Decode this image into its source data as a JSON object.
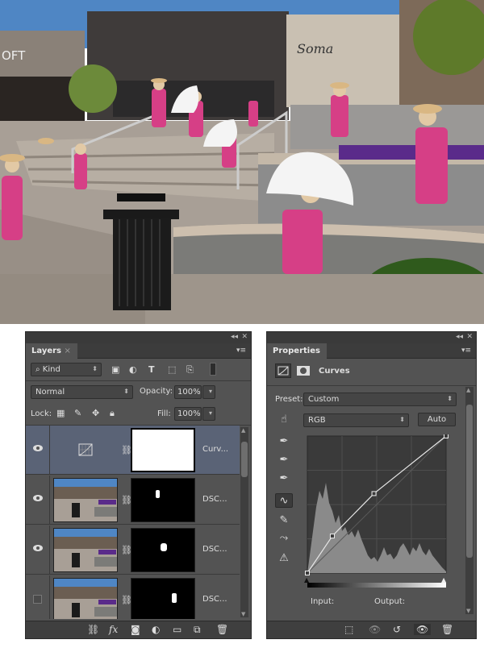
{
  "layers_panel": {
    "tab_label": "Layers",
    "filter_kind": "Kind",
    "blend_mode": "Normal",
    "opacity_label": "Opacity:",
    "opacity_value": "100%",
    "lock_label": "Lock:",
    "fill_label": "Fill:",
    "fill_value": "100%",
    "layers": [
      {
        "name": "Curv...",
        "visible": true,
        "selected": true,
        "type": "adjustment"
      },
      {
        "name": "DSC...",
        "visible": true,
        "selected": false,
        "type": "photo"
      },
      {
        "name": "DSC...",
        "visible": true,
        "selected": false,
        "type": "photo"
      },
      {
        "name": "DSC...",
        "visible": false,
        "selected": false,
        "type": "photo"
      }
    ]
  },
  "properties_panel": {
    "tab_label": "Properties",
    "title": "Curves",
    "preset_label": "Preset:",
    "preset_value": "Custom",
    "channel": "RGB",
    "auto_label": "Auto",
    "input_label": "Input:",
    "output_label": "Output:",
    "curve_points": [
      [
        0,
        0
      ],
      [
        0.18,
        0.27
      ],
      [
        0.48,
        0.58
      ],
      [
        1,
        1
      ]
    ]
  },
  "colors": {
    "panel_bg": "#535353",
    "selected_row": "#5a6376",
    "sky": "#4f86c4"
  }
}
